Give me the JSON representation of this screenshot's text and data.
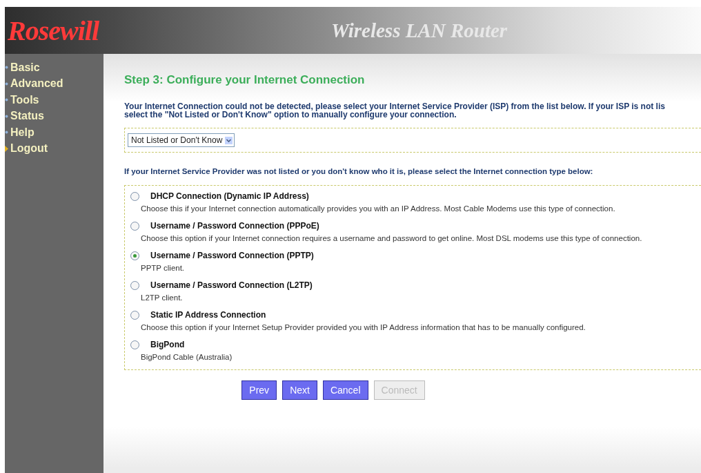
{
  "header": {
    "logo": "Rosewill",
    "title": "Wireless LAN Router"
  },
  "sidebar": {
    "items": [
      {
        "label": "Basic",
        "kind": "bullet"
      },
      {
        "label": "Advanced",
        "kind": "bullet"
      },
      {
        "label": "Tools",
        "kind": "bullet"
      },
      {
        "label": "Status",
        "kind": "bullet"
      },
      {
        "label": "Help",
        "kind": "bullet"
      },
      {
        "label": "Logout",
        "kind": "arrow"
      }
    ]
  },
  "heading": "Step 3: Configure your Internet Connection",
  "intro": [
    "Your Internet Connection could not be detected, please select your Internet Service Provider (ISP) from the list below. If your ISP is not lis",
    "select the \"Not Listed or Don't Know\" option to manually configure your connection."
  ],
  "isp_select": {
    "value": "Not Listed or Don't Know"
  },
  "type_prompt": "If your Internet Service Provider was not listed or you don't know who it is, please select the Internet connection type below:",
  "connection_types": [
    {
      "label": "DHCP Connection (Dynamic IP Address)",
      "description": "Choose this if your Internet connection automatically provides you with an IP Address. Most Cable Modems use this type of connection.",
      "selected": false
    },
    {
      "label": "Username / Password Connection (PPPoE)",
      "description": "Choose this option if your Internet connection requires a username and password to get online. Most DSL modems use this type of connection.",
      "selected": false
    },
    {
      "label": "Username / Password Connection (PPTP)",
      "description": "PPTP client.",
      "selected": true
    },
    {
      "label": "Username / Password Connection (L2TP)",
      "description": "L2TP client.",
      "selected": false
    },
    {
      "label": "Static IP Address Connection",
      "description": "Choose this option if your Internet Setup Provider provided you with IP Address information that has to be manually configured.",
      "selected": false
    },
    {
      "label": "BigPond",
      "description": "BigPond Cable (Australia)",
      "selected": false
    }
  ],
  "buttons": [
    {
      "label": "Prev",
      "disabled": false
    },
    {
      "label": "Next",
      "disabled": false
    },
    {
      "label": "Cancel",
      "disabled": false
    },
    {
      "label": "Connect",
      "disabled": true
    }
  ]
}
